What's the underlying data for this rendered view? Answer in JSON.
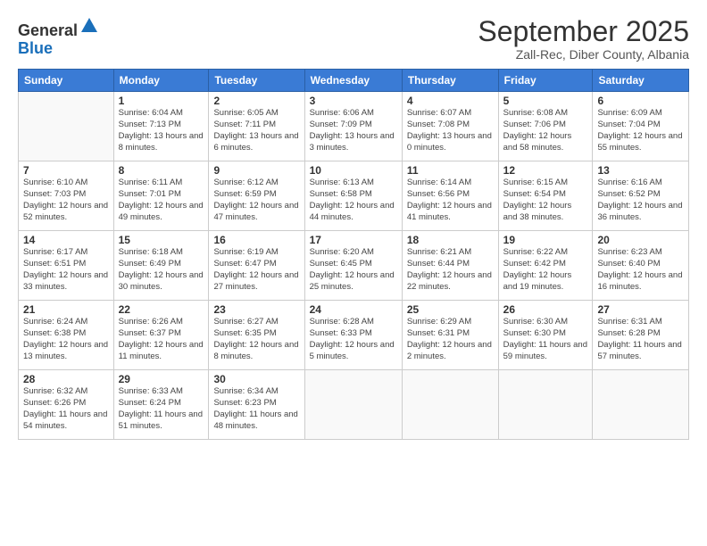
{
  "logo": {
    "general": "General",
    "blue": "Blue"
  },
  "header": {
    "month": "September 2025",
    "location": "Zall-Rec, Diber County, Albania"
  },
  "weekdays": [
    "Sunday",
    "Monday",
    "Tuesday",
    "Wednesday",
    "Thursday",
    "Friday",
    "Saturday"
  ],
  "weeks": [
    [
      {
        "day": null
      },
      {
        "day": 1,
        "sunrise": "6:04 AM",
        "sunset": "7:13 PM",
        "daylight": "13 hours and 8 minutes."
      },
      {
        "day": 2,
        "sunrise": "6:05 AM",
        "sunset": "7:11 PM",
        "daylight": "13 hours and 6 minutes."
      },
      {
        "day": 3,
        "sunrise": "6:06 AM",
        "sunset": "7:09 PM",
        "daylight": "13 hours and 3 minutes."
      },
      {
        "day": 4,
        "sunrise": "6:07 AM",
        "sunset": "7:08 PM",
        "daylight": "13 hours and 0 minutes."
      },
      {
        "day": 5,
        "sunrise": "6:08 AM",
        "sunset": "7:06 PM",
        "daylight": "12 hours and 58 minutes."
      },
      {
        "day": 6,
        "sunrise": "6:09 AM",
        "sunset": "7:04 PM",
        "daylight": "12 hours and 55 minutes."
      }
    ],
    [
      {
        "day": 7,
        "sunrise": "6:10 AM",
        "sunset": "7:03 PM",
        "daylight": "12 hours and 52 minutes."
      },
      {
        "day": 8,
        "sunrise": "6:11 AM",
        "sunset": "7:01 PM",
        "daylight": "12 hours and 49 minutes."
      },
      {
        "day": 9,
        "sunrise": "6:12 AM",
        "sunset": "6:59 PM",
        "daylight": "12 hours and 47 minutes."
      },
      {
        "day": 10,
        "sunrise": "6:13 AM",
        "sunset": "6:58 PM",
        "daylight": "12 hours and 44 minutes."
      },
      {
        "day": 11,
        "sunrise": "6:14 AM",
        "sunset": "6:56 PM",
        "daylight": "12 hours and 41 minutes."
      },
      {
        "day": 12,
        "sunrise": "6:15 AM",
        "sunset": "6:54 PM",
        "daylight": "12 hours and 38 minutes."
      },
      {
        "day": 13,
        "sunrise": "6:16 AM",
        "sunset": "6:52 PM",
        "daylight": "12 hours and 36 minutes."
      }
    ],
    [
      {
        "day": 14,
        "sunrise": "6:17 AM",
        "sunset": "6:51 PM",
        "daylight": "12 hours and 33 minutes."
      },
      {
        "day": 15,
        "sunrise": "6:18 AM",
        "sunset": "6:49 PM",
        "daylight": "12 hours and 30 minutes."
      },
      {
        "day": 16,
        "sunrise": "6:19 AM",
        "sunset": "6:47 PM",
        "daylight": "12 hours and 27 minutes."
      },
      {
        "day": 17,
        "sunrise": "6:20 AM",
        "sunset": "6:45 PM",
        "daylight": "12 hours and 25 minutes."
      },
      {
        "day": 18,
        "sunrise": "6:21 AM",
        "sunset": "6:44 PM",
        "daylight": "12 hours and 22 minutes."
      },
      {
        "day": 19,
        "sunrise": "6:22 AM",
        "sunset": "6:42 PM",
        "daylight": "12 hours and 19 minutes."
      },
      {
        "day": 20,
        "sunrise": "6:23 AM",
        "sunset": "6:40 PM",
        "daylight": "12 hours and 16 minutes."
      }
    ],
    [
      {
        "day": 21,
        "sunrise": "6:24 AM",
        "sunset": "6:38 PM",
        "daylight": "12 hours and 13 minutes."
      },
      {
        "day": 22,
        "sunrise": "6:26 AM",
        "sunset": "6:37 PM",
        "daylight": "12 hours and 11 minutes."
      },
      {
        "day": 23,
        "sunrise": "6:27 AM",
        "sunset": "6:35 PM",
        "daylight": "12 hours and 8 minutes."
      },
      {
        "day": 24,
        "sunrise": "6:28 AM",
        "sunset": "6:33 PM",
        "daylight": "12 hours and 5 minutes."
      },
      {
        "day": 25,
        "sunrise": "6:29 AM",
        "sunset": "6:31 PM",
        "daylight": "12 hours and 2 minutes."
      },
      {
        "day": 26,
        "sunrise": "6:30 AM",
        "sunset": "6:30 PM",
        "daylight": "11 hours and 59 minutes."
      },
      {
        "day": 27,
        "sunrise": "6:31 AM",
        "sunset": "6:28 PM",
        "daylight": "11 hours and 57 minutes."
      }
    ],
    [
      {
        "day": 28,
        "sunrise": "6:32 AM",
        "sunset": "6:26 PM",
        "daylight": "11 hours and 54 minutes."
      },
      {
        "day": 29,
        "sunrise": "6:33 AM",
        "sunset": "6:24 PM",
        "daylight": "11 hours and 51 minutes."
      },
      {
        "day": 30,
        "sunrise": "6:34 AM",
        "sunset": "6:23 PM",
        "daylight": "11 hours and 48 minutes."
      },
      {
        "day": null
      },
      {
        "day": null
      },
      {
        "day": null
      },
      {
        "day": null
      }
    ]
  ]
}
